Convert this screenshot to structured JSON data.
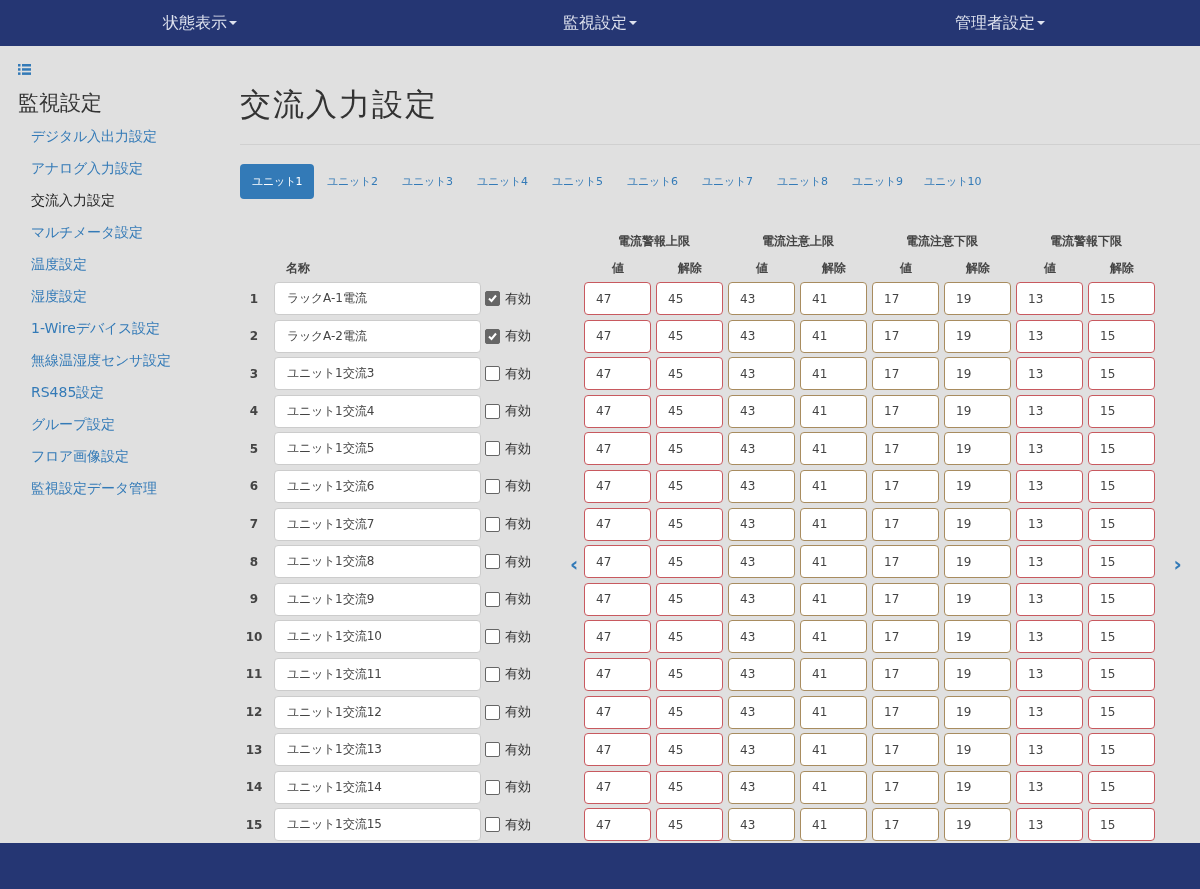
{
  "navbar": {
    "menus": [
      {
        "label": "状態表示"
      },
      {
        "label": "監視設定"
      },
      {
        "label": "管理者設定"
      }
    ]
  },
  "sidebar": {
    "title": "監視設定",
    "items": [
      {
        "label": "デジタル入出力設定",
        "selected": false
      },
      {
        "label": "アナログ入力設定",
        "selected": false
      },
      {
        "label": "交流入力設定",
        "selected": true
      },
      {
        "label": "マルチメータ設定",
        "selected": false
      },
      {
        "label": "温度設定",
        "selected": false
      },
      {
        "label": "湿度設定",
        "selected": false
      },
      {
        "label": "1-Wireデバイス設定",
        "selected": false
      },
      {
        "label": "無線温湿度センサ設定",
        "selected": false
      },
      {
        "label": "RS485設定",
        "selected": false
      },
      {
        "label": "グループ設定",
        "selected": false
      },
      {
        "label": "フロア画像設定",
        "selected": false
      },
      {
        "label": "監視設定データ管理",
        "selected": false
      }
    ]
  },
  "page_title": "交流入力設定",
  "tabs": [
    {
      "label": "ユニット1",
      "selected": true
    },
    {
      "label": "ユニット2",
      "selected": false
    },
    {
      "label": "ユニット3",
      "selected": false
    },
    {
      "label": "ユニット4",
      "selected": false
    },
    {
      "label": "ユニット5",
      "selected": false
    },
    {
      "label": "ユニット6",
      "selected": false
    },
    {
      "label": "ユニット7",
      "selected": false
    },
    {
      "label": "ユニット8",
      "selected": false
    },
    {
      "label": "ユニット9",
      "selected": false
    },
    {
      "label": "ユニット10",
      "selected": false
    }
  ],
  "table": {
    "name_header": "名称",
    "prev_arrow": "‹",
    "next_arrow": "›",
    "groups": [
      {
        "title": "電流警報上限",
        "color": "#c8595f",
        "columns": [
          "値",
          "解除"
        ]
      },
      {
        "title": "電流注意上限",
        "color": "#a88c5f",
        "columns": [
          "値",
          "解除"
        ]
      },
      {
        "title": "電流注意下限",
        "color": "#a88c5f",
        "columns": [
          "値",
          "解除"
        ]
      },
      {
        "title": "電流警報下限",
        "color": "#c8595f",
        "columns": [
          "値",
          "解除"
        ]
      }
    ],
    "rows": [
      {
        "number": "1",
        "name": "ラックA-1電流",
        "enabled": true,
        "enabled_label": "有効",
        "values": [
          "47",
          "45",
          "43",
          "41",
          "17",
          "19",
          "13",
          "15"
        ]
      },
      {
        "number": "2",
        "name": "ラックA-2電流",
        "enabled": true,
        "enabled_label": "有効",
        "values": [
          "47",
          "45",
          "43",
          "41",
          "17",
          "19",
          "13",
          "15"
        ]
      },
      {
        "number": "3",
        "name": "ユニット1交流3",
        "enabled": false,
        "enabled_label": "有効",
        "values": [
          "47",
          "45",
          "43",
          "41",
          "17",
          "19",
          "13",
          "15"
        ]
      },
      {
        "number": "4",
        "name": "ユニット1交流4",
        "enabled": false,
        "enabled_label": "有効",
        "values": [
          "47",
          "45",
          "43",
          "41",
          "17",
          "19",
          "13",
          "15"
        ]
      },
      {
        "number": "5",
        "name": "ユニット1交流5",
        "enabled": false,
        "enabled_label": "有効",
        "values": [
          "47",
          "45",
          "43",
          "41",
          "17",
          "19",
          "13",
          "15"
        ]
      },
      {
        "number": "6",
        "name": "ユニット1交流6",
        "enabled": false,
        "enabled_label": "有効",
        "values": [
          "47",
          "45",
          "43",
          "41",
          "17",
          "19",
          "13",
          "15"
        ]
      },
      {
        "number": "7",
        "name": "ユニット1交流7",
        "enabled": false,
        "enabled_label": "有効",
        "values": [
          "47",
          "45",
          "43",
          "41",
          "17",
          "19",
          "13",
          "15"
        ]
      },
      {
        "number": "8",
        "name": "ユニット1交流8",
        "enabled": false,
        "enabled_label": "有効",
        "values": [
          "47",
          "45",
          "43",
          "41",
          "17",
          "19",
          "13",
          "15"
        ]
      },
      {
        "number": "9",
        "name": "ユニット1交流9",
        "enabled": false,
        "enabled_label": "有効",
        "values": [
          "47",
          "45",
          "43",
          "41",
          "17",
          "19",
          "13",
          "15"
        ]
      },
      {
        "number": "10",
        "name": "ユニット1交流10",
        "enabled": false,
        "enabled_label": "有効",
        "values": [
          "47",
          "45",
          "43",
          "41",
          "17",
          "19",
          "13",
          "15"
        ]
      },
      {
        "number": "11",
        "name": "ユニット1交流11",
        "enabled": false,
        "enabled_label": "有効",
        "values": [
          "47",
          "45",
          "43",
          "41",
          "17",
          "19",
          "13",
          "15"
        ]
      },
      {
        "number": "12",
        "name": "ユニット1交流12",
        "enabled": false,
        "enabled_label": "有効",
        "values": [
          "47",
          "45",
          "43",
          "41",
          "17",
          "19",
          "13",
          "15"
        ]
      },
      {
        "number": "13",
        "name": "ユニット1交流13",
        "enabled": false,
        "enabled_label": "有効",
        "values": [
          "47",
          "45",
          "43",
          "41",
          "17",
          "19",
          "13",
          "15"
        ]
      },
      {
        "number": "14",
        "name": "ユニット1交流14",
        "enabled": false,
        "enabled_label": "有効",
        "values": [
          "47",
          "45",
          "43",
          "41",
          "17",
          "19",
          "13",
          "15"
        ]
      },
      {
        "number": "15",
        "name": "ユニット1交流15",
        "enabled": false,
        "enabled_label": "有効",
        "values": [
          "47",
          "45",
          "43",
          "41",
          "17",
          "19",
          "13",
          "15"
        ]
      }
    ]
  }
}
